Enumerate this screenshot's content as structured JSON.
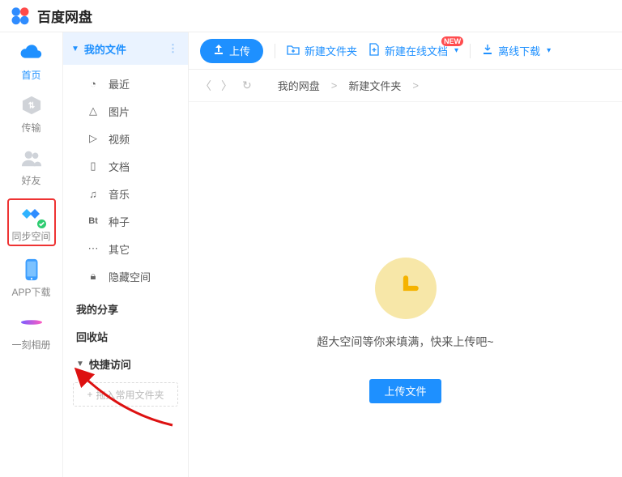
{
  "header": {
    "brand": "百度网盘"
  },
  "rail": {
    "items": [
      {
        "label": "首页"
      },
      {
        "label": "传输"
      },
      {
        "label": "好友"
      },
      {
        "label": "同步空间"
      },
      {
        "label": "APP下载"
      },
      {
        "label": "一刻相册"
      }
    ]
  },
  "tree": {
    "top": "我的文件",
    "items": [
      {
        "label": "最近"
      },
      {
        "label": "图片"
      },
      {
        "label": "视频"
      },
      {
        "label": "文档"
      },
      {
        "label": "音乐"
      },
      {
        "label": "种子"
      },
      {
        "label": "其它"
      },
      {
        "label": "隐藏空间"
      }
    ],
    "sections": {
      "share": "我的分享",
      "recycle": "回收站",
      "quick": "快捷访问"
    },
    "add_folder_placeholder": "拖入常用文件夹"
  },
  "toolbar": {
    "upload": "上传",
    "new_folder": "新建文件夹",
    "new_online_doc": "新建在线文档",
    "offline_download": "离线下载",
    "badge_new": "NEW"
  },
  "breadcrumbs": {
    "root": "我的网盘",
    "folder": "新建文件夹",
    "sep": ">"
  },
  "empty": {
    "message": "超大空间等你来填满，快来上传吧~",
    "upload_button": "上传文件"
  }
}
